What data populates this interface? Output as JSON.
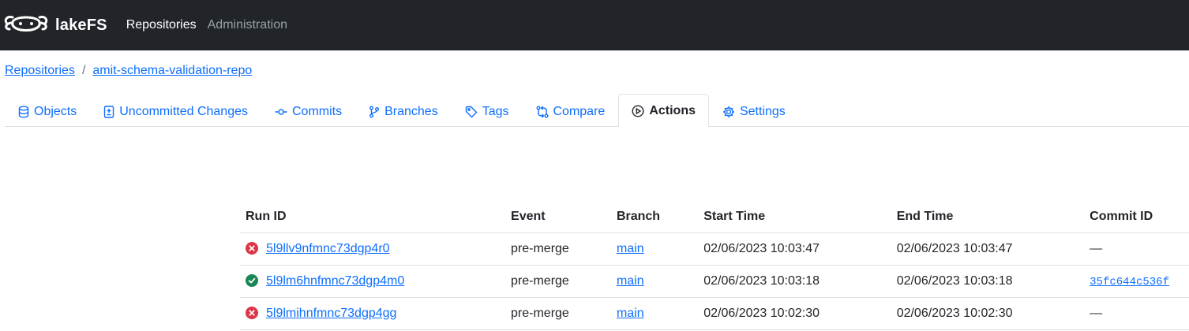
{
  "navbar": {
    "brand": "lakeFS",
    "links": [
      "Repositories",
      "Administration"
    ]
  },
  "breadcrumb": {
    "root": "Repositories",
    "separator": "/",
    "repo": "amit-schema-validation-repo"
  },
  "tabs": [
    {
      "label": "Objects",
      "icon": "database-icon"
    },
    {
      "label": "Uncommitted Changes",
      "icon": "file-diff-icon"
    },
    {
      "label": "Commits",
      "icon": "git-commit-icon"
    },
    {
      "label": "Branches",
      "icon": "git-branch-icon"
    },
    {
      "label": "Tags",
      "icon": "tag-icon"
    },
    {
      "label": "Compare",
      "icon": "git-compare-icon"
    },
    {
      "label": "Actions",
      "icon": "play-circle-icon",
      "active": true
    },
    {
      "label": "Settings",
      "icon": "gear-icon"
    }
  ],
  "table": {
    "headers": [
      "Run ID",
      "Event",
      "Branch",
      "Start Time",
      "End Time",
      "Commit ID"
    ],
    "rows": [
      {
        "status": "failed",
        "run_id": "5l9llv9nfmnc73dgp4r0",
        "event": "pre-merge",
        "branch": "main",
        "start_time": "02/06/2023 10:03:47",
        "end_time": "02/06/2023 10:03:47",
        "commit_id": "—"
      },
      {
        "status": "completed",
        "run_id": "5l9lm6hnfmnc73dgp4m0",
        "event": "pre-merge",
        "branch": "main",
        "start_time": "02/06/2023 10:03:18",
        "end_time": "02/06/2023 10:03:18",
        "commit_id": "35fc644c536f"
      },
      {
        "status": "failed",
        "run_id": "5l9lmihnfmnc73dgp4gg",
        "event": "pre-merge",
        "branch": "main",
        "start_time": "02/06/2023 10:02:30",
        "end_time": "02/06/2023 10:02:30",
        "commit_id": "—"
      }
    ]
  },
  "colors": {
    "navbar_bg": "#212529",
    "link": "#0d6efd",
    "failed": "#dc3545",
    "success": "#198754"
  }
}
